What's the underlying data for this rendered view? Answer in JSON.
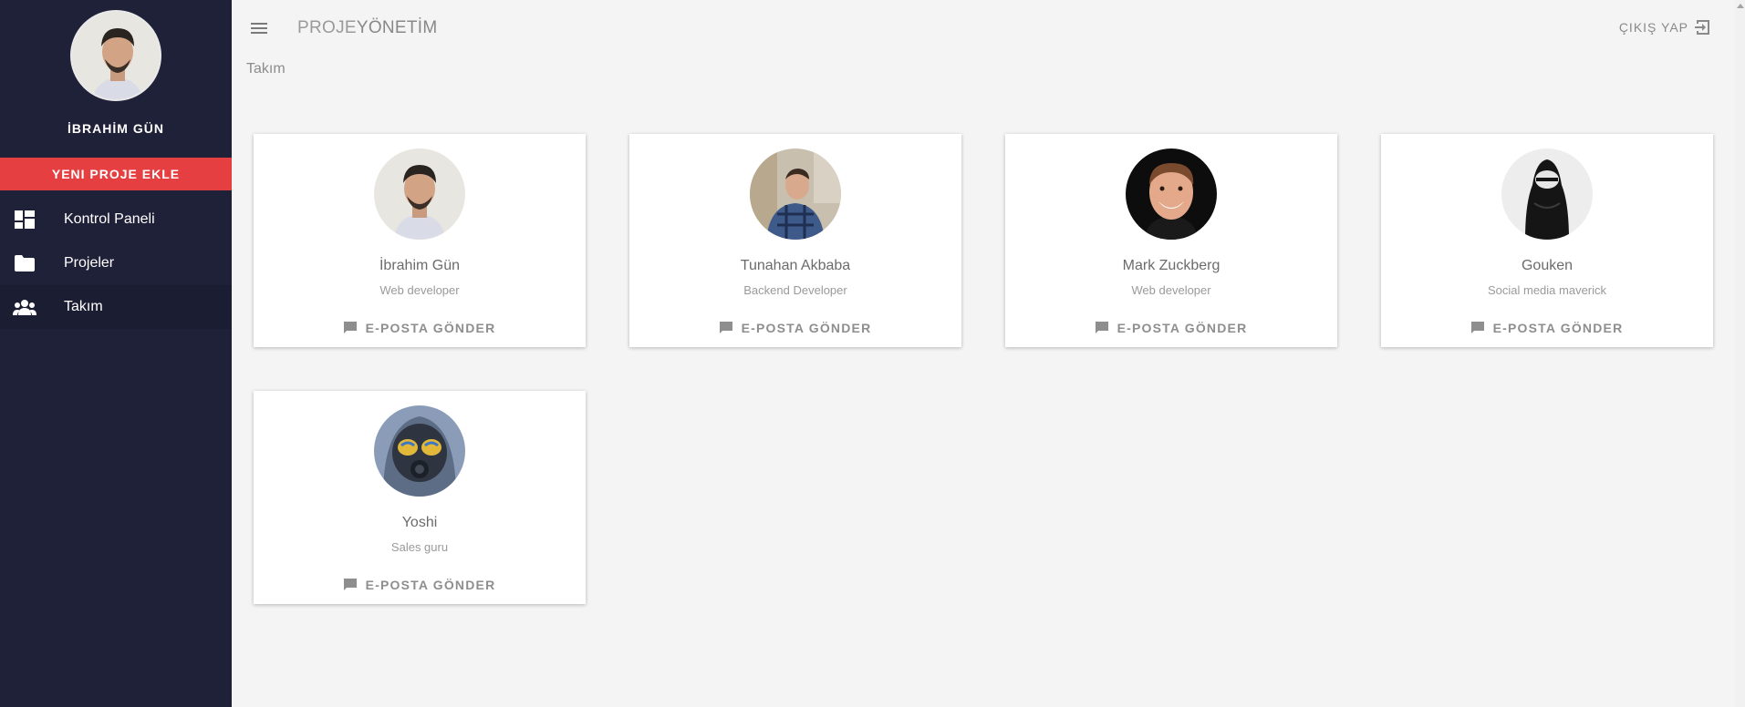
{
  "sidebar": {
    "user_name": "İBRAHİM GÜN",
    "new_project_label": "YENI PROJE EKLE",
    "items": [
      {
        "label": "Kontrol Paneli",
        "icon": "dashboard-icon"
      },
      {
        "label": "Projeler",
        "icon": "folder-icon"
      },
      {
        "label": "Takım",
        "icon": "group-icon"
      }
    ]
  },
  "header": {
    "brand_part1": "PROJE",
    "brand_part2": "YÖNETİM",
    "logout_label": "ÇIKIŞ YAP"
  },
  "breadcrumb": "Takım",
  "team": [
    {
      "name": "İbrahim Gün",
      "role": "Web developer",
      "action": "E-POSTA GÖNDER"
    },
    {
      "name": "Tunahan Akbaba",
      "role": "Backend Developer",
      "action": "E-POSTA GÖNDER"
    },
    {
      "name": "Mark Zuckberg",
      "role": "Web developer",
      "action": "E-POSTA GÖNDER"
    },
    {
      "name": "Gouken",
      "role": "Social media maverick",
      "action": "E-POSTA GÖNDER"
    },
    {
      "name": "Yoshi",
      "role": "Sales guru",
      "action": "E-POSTA GÖNDER"
    }
  ],
  "colors": {
    "sidebar_bg": "#1f2139",
    "accent": "#e53f42",
    "page_bg": "#f4f4f4"
  }
}
